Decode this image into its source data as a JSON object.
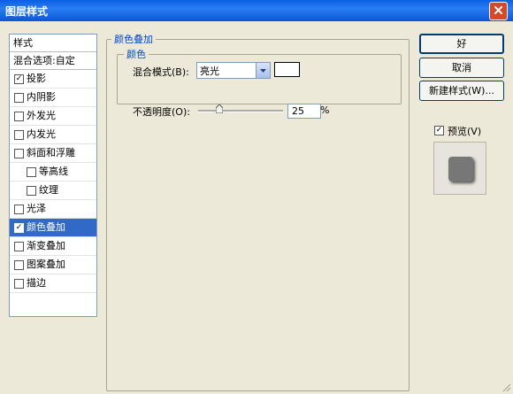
{
  "window": {
    "title": "图层样式"
  },
  "style_list": {
    "header": "样式",
    "blend_options": "混合选项:自定",
    "items": [
      {
        "label": "投影",
        "checked": true,
        "selected": false,
        "indent": false
      },
      {
        "label": "内阴影",
        "checked": false,
        "selected": false,
        "indent": false
      },
      {
        "label": "外发光",
        "checked": false,
        "selected": false,
        "indent": false
      },
      {
        "label": "内发光",
        "checked": false,
        "selected": false,
        "indent": false
      },
      {
        "label": "斜面和浮雕",
        "checked": false,
        "selected": false,
        "indent": false
      },
      {
        "label": "等高线",
        "checked": false,
        "selected": false,
        "indent": true
      },
      {
        "label": "纹理",
        "checked": false,
        "selected": false,
        "indent": true
      },
      {
        "label": "光泽",
        "checked": false,
        "selected": false,
        "indent": false
      },
      {
        "label": "颜色叠加",
        "checked": true,
        "selected": true,
        "indent": false
      },
      {
        "label": "渐变叠加",
        "checked": false,
        "selected": false,
        "indent": false
      },
      {
        "label": "图案叠加",
        "checked": false,
        "selected": false,
        "indent": false
      },
      {
        "label": "描边",
        "checked": false,
        "selected": false,
        "indent": false
      }
    ]
  },
  "panel": {
    "group_title": "颜色叠加",
    "subgroup_title": "颜色",
    "blend_mode_label": "混合模式(B):",
    "blend_mode_value": "亮光",
    "overlay_color": "#ffffff",
    "opacity_label": "不透明度(O):",
    "opacity_value": "25",
    "opacity_unit": "%",
    "opacity_fraction": 0.25
  },
  "buttons": {
    "ok": "好",
    "cancel": "取消",
    "new_style": "新建样式(W)..."
  },
  "preview": {
    "label": "预览(V)",
    "checked": true
  },
  "colors": {
    "selection": "#3169c6",
    "title_bar": "#0a5fe3",
    "accent_text": "#0046d5"
  }
}
